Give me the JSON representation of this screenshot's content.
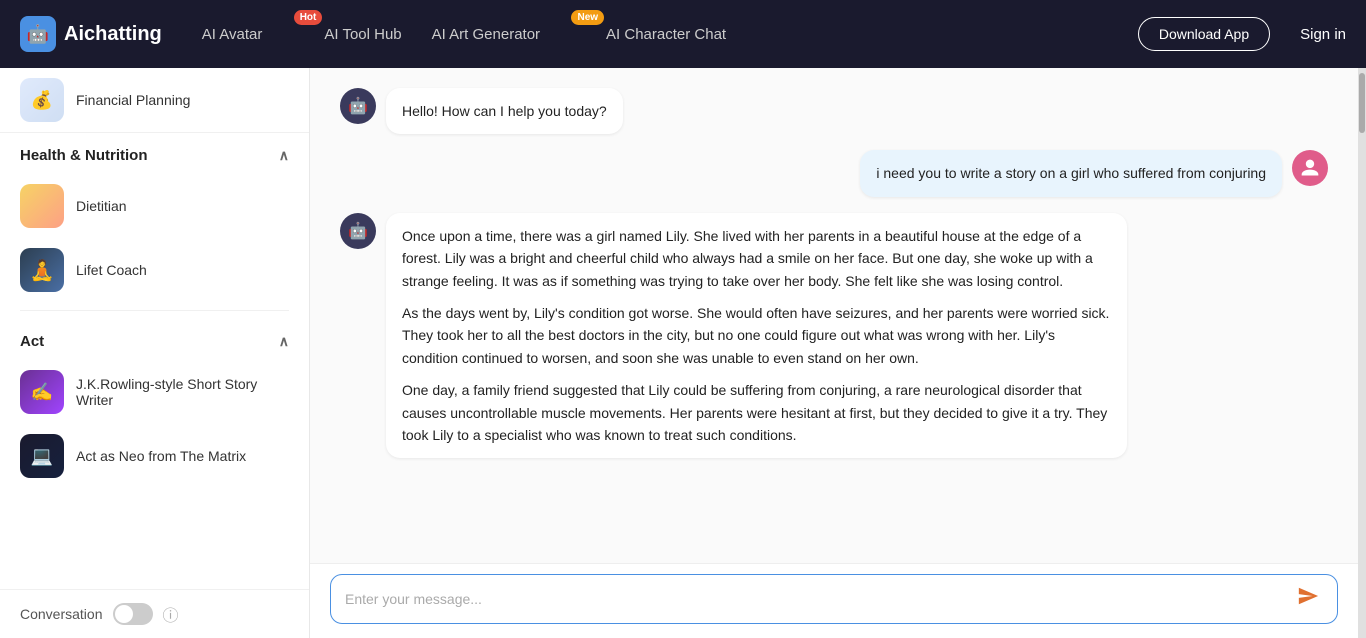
{
  "navbar": {
    "brand": "Aichatting",
    "items": [
      {
        "label": "AI Avatar",
        "badge": "Hot",
        "badge_type": "hot"
      },
      {
        "label": "AI Tool Hub",
        "badge": null
      },
      {
        "label": "AI Art Generator",
        "badge": "New",
        "badge_type": "new"
      },
      {
        "label": "AI Character Chat",
        "badge": null
      }
    ],
    "download_label": "Download App",
    "signin_label": "Sign in"
  },
  "sidebar": {
    "sections": [
      {
        "title": "Health & Nutrition",
        "items": [
          {
            "label": "Dietitian",
            "img_class": "img-dietitian",
            "icon": "🥗"
          },
          {
            "label": "Lifet Coach",
            "img_class": "img-lifet",
            "icon": "🧘"
          }
        ]
      },
      {
        "title": "Act",
        "items": [
          {
            "label": "J.K.Rowling-style Short Story Writer",
            "img_class": "img-jkrowling",
            "icon": "✍️"
          },
          {
            "label": "Act as Neo from The Matrix",
            "img_class": "img-neo",
            "icon": "💻"
          }
        ]
      }
    ],
    "conversation_label": "Conversation",
    "financial_item": "Financial Planning"
  },
  "chat": {
    "messages": [
      {
        "role": "assistant",
        "text": "Hello! How can I help you today?"
      },
      {
        "role": "user",
        "text": "i need you to write a story on a girl who suffered from conjuring"
      },
      {
        "role": "assistant",
        "paragraphs": [
          "Once upon a time, there was a girl named Lily. She lived with her parents in a beautiful house at the edge of a forest. Lily was a bright and cheerful child who always had a smile on her face. But one day, she woke up with a strange feeling. It was as if something was trying to take over her body. She felt like she was losing control.",
          "As the days went by, Lily's condition got worse. She would often have seizures, and her parents were worried sick. They took her to all the best doctors in the city, but no one could figure out what was wrong with her. Lily's condition continued to worsen, and soon she was unable to even stand on her own.",
          "One day, a family friend suggested that Lily could be suffering from conjuring, a rare neurological disorder that causes uncontrollable muscle movements. Her parents were hesitant at first, but they decided to give it a try. They took Lily to a specialist who was known to treat such conditions."
        ]
      }
    ],
    "input_placeholder": "Enter your message..."
  }
}
